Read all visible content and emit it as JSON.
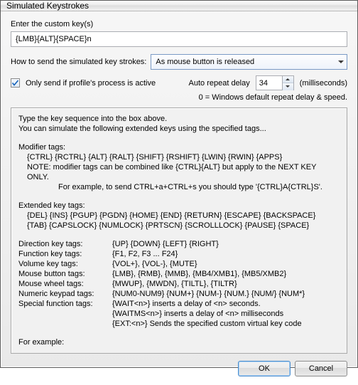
{
  "window": {
    "title": "Simulated Keystrokes"
  },
  "labels": {
    "enter_keys": "Enter the custom key(s)",
    "how_to_send": "How to send the simulated key strokes:",
    "only_send": "Only send if profile's process is active",
    "auto_repeat": "Auto repeat delay",
    "ms": "(milliseconds)",
    "default_note": "0 = Windows default repeat delay & speed."
  },
  "inputs": {
    "custom_keys": "{LMB}{ALT}{SPACE}n",
    "send_mode": "As mouse button is released",
    "only_send_checked": true,
    "repeat_delay": "34"
  },
  "help": {
    "intro1": "Type the key sequence into the box above.",
    "intro2": "You can simulate the following extended keys using the specified tags...",
    "mod_hdr": "Modifier tags:",
    "mod_tags": "{CTRL} {RCTRL} {ALT} {RALT} {SHIFT} {RSHIFT} {LWIN} {RWIN} {APPS}",
    "mod_note1": "NOTE:    modifier tags can be combined like {CTRL}{ALT} but apply to the NEXT KEY ONLY.",
    "mod_note2": "For example, to send CTRL+a+CTRL+s you should type '{CTRL}A{CTRL}S'.",
    "ext_hdr": "Extended key tags:",
    "ext_tags1": "{DEL} {INS} {PGUP} {PGDN} {HOME} {END} {RETURN} {ESCAPE} {BACKSPACE}",
    "ext_tags2": "{TAB} {CAPSLOCK} {NUMLOCK} {PRTSCN} {SCROLLLOCK} {PAUSE} {SPACE}",
    "grid": [
      [
        "Direction key tags:",
        "{UP} {DOWN} {LEFT} {RIGHT}"
      ],
      [
        "Function key tags:",
        "{F1, F2, F3 ... F24}"
      ],
      [
        "Volume key tags:",
        "{VOL+}, {VOL-}, {MUTE}"
      ],
      [
        "Mouse button tags:",
        "{LMB}, {RMB}, {MMB}, {MB4/XMB1}, {MB5/XMB2}"
      ],
      [
        "Mouse wheel tags:",
        "{MWUP}, {MWDN}, {TILTL}, {TILTR}"
      ],
      [
        "Numeric keypad tags:",
        "{NUM0-NUM9} {NUM+} {NUM-} {NUM.} {NUM/} {NUM*}"
      ],
      [
        "Special function tags:",
        "{WAIT<n>} inserts a delay of <n> seconds."
      ],
      [
        "",
        "{WAITMS<n>} inserts a delay of <n> milliseconds"
      ],
      [
        "",
        "{EXT:<n>} Sends the specified custom virtual key code"
      ]
    ],
    "for_example": "For example:"
  },
  "buttons": {
    "ok": "OK",
    "cancel": "Cancel"
  }
}
